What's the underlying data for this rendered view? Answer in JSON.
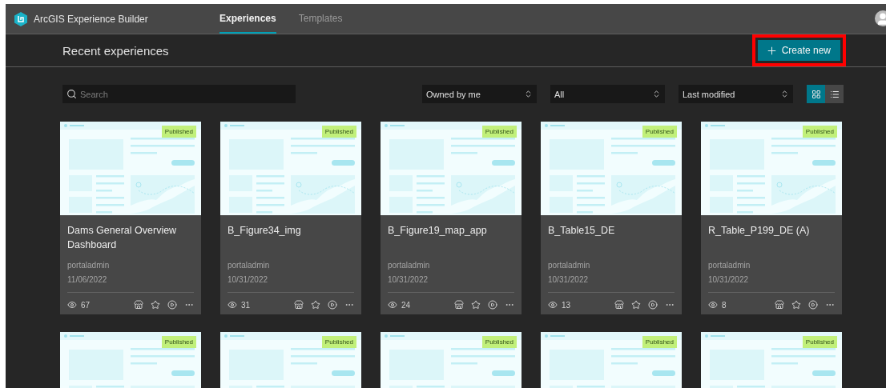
{
  "app": {
    "title": "ArcGIS Experience Builder"
  },
  "tabs": [
    {
      "label": "Experiences",
      "selected": true
    },
    {
      "label": "Templates",
      "selected": false
    }
  ],
  "page_title": "Recent experiences",
  "create_button": {
    "label": "Create new",
    "highlighted": true
  },
  "search": {
    "placeholder": "Search"
  },
  "filters": [
    {
      "value": "Owned by me"
    },
    {
      "value": "All"
    },
    {
      "value": "Last modified"
    }
  ],
  "view_toggle": [
    {
      "kind": "grid",
      "selected": true
    },
    {
      "kind": "list",
      "selected": false
    }
  ],
  "cards": [
    {
      "title": "Dams General Overview Dashboard",
      "owner": "portaladmin",
      "date": "11/06/2022",
      "views": "67",
      "status": "Published"
    },
    {
      "title": "B_Figure34_img",
      "owner": "portaladmin",
      "date": "10/31/2022",
      "views": "31",
      "status": "Published"
    },
    {
      "title": "B_Figure19_map_app",
      "owner": "portaladmin",
      "date": "10/31/2022",
      "views": "24",
      "status": "Published"
    },
    {
      "title": "B_Table15_DE",
      "owner": "portaladmin",
      "date": "10/31/2022",
      "views": "13",
      "status": "Published"
    },
    {
      "title": "R_Table_P199_DE (A)",
      "owner": "portaladmin",
      "date": "10/31/2022",
      "views": "8",
      "status": "Published"
    }
  ],
  "more_cards": [
    {
      "status": "Published"
    },
    {
      "status": "Published"
    },
    {
      "status": "Published"
    },
    {
      "status": "Published"
    },
    {
      "status": "Published"
    }
  ]
}
